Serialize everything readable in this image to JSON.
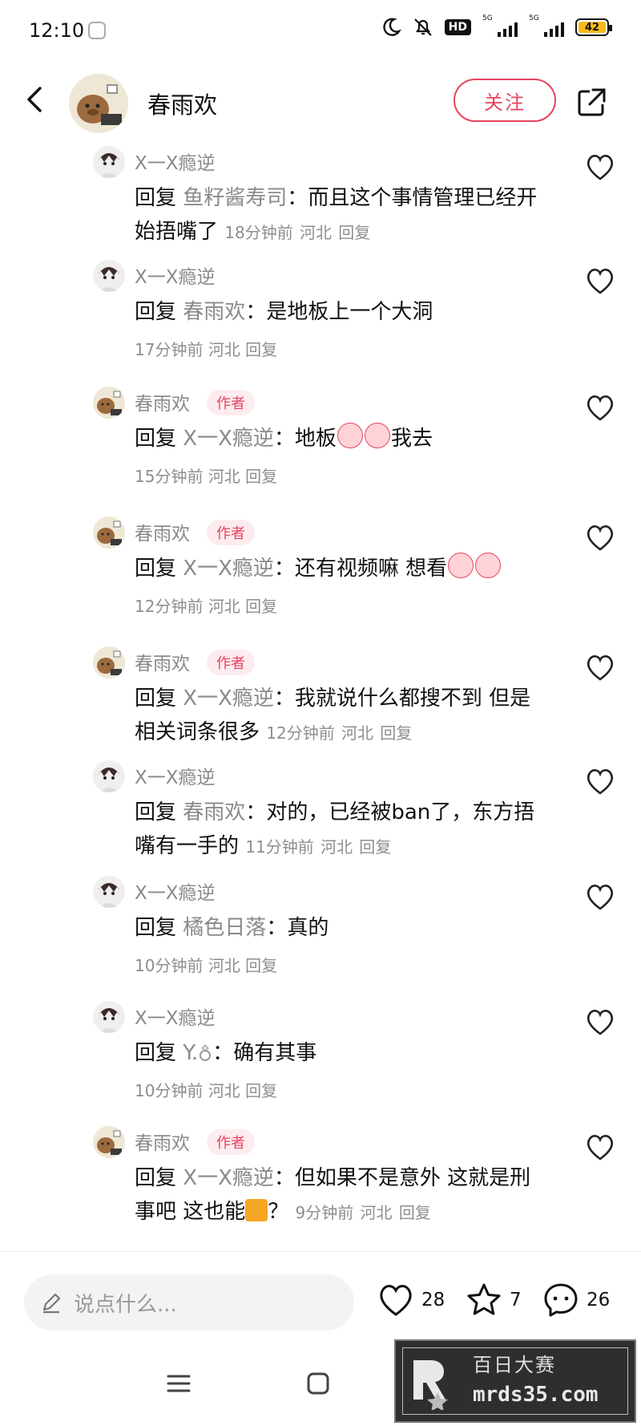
{
  "status_bar": {
    "time": "12:10",
    "hd_label": "HD",
    "network_1": "5G",
    "network_2": "5G",
    "battery": "42"
  },
  "header": {
    "author_name": "春雨欢",
    "follow_label": "关注"
  },
  "comments": [
    {
      "user": "X一X瘾逆",
      "is_author": false,
      "reply_word": "回复",
      "reply_to": "鱼籽酱寿司",
      "text": "而且这个事情管理已经开始捂嘴了",
      "time": "18分钟前",
      "location": "河北",
      "reply_label": "回复"
    },
    {
      "user": "X一X瘾逆",
      "is_author": false,
      "reply_word": "回复",
      "reply_to": "春雨欢",
      "text": "是地板上一个大洞",
      "time": "17分钟前",
      "location": "河北",
      "reply_label": "回复"
    },
    {
      "user": "春雨欢",
      "is_author": true,
      "author_badge": "作者",
      "reply_word": "回复",
      "reply_to": "X一X瘾逆",
      "text_before": "地板",
      "text_after": "我去",
      "time": "15分钟前",
      "location": "河北",
      "reply_label": "回复"
    },
    {
      "user": "春雨欢",
      "is_author": true,
      "author_badge": "作者",
      "reply_word": "回复",
      "reply_to": "X一X瘾逆",
      "text": "还有视频嘛 想看",
      "time": "12分钟前",
      "location": "河北",
      "reply_label": "回复"
    },
    {
      "user": "春雨欢",
      "is_author": true,
      "author_badge": "作者",
      "reply_word": "回复",
      "reply_to": "X一X瘾逆",
      "text": "我就说什么都搜不到 但是相关词条很多",
      "time": "12分钟前",
      "location": "河北",
      "reply_label": "回复"
    },
    {
      "user": "X一X瘾逆",
      "is_author": false,
      "reply_word": "回复",
      "reply_to": "春雨欢",
      "text": "对的，已经被ban了，东方捂嘴有一手的",
      "time": "11分钟前",
      "location": "河北",
      "reply_label": "回复"
    },
    {
      "user": "X一X瘾逆",
      "is_author": false,
      "reply_word": "回复",
      "reply_to": "橘色日落",
      "text": "真的",
      "time": "10分钟前",
      "location": "河北",
      "reply_label": "回复"
    },
    {
      "user": "X一X瘾逆",
      "is_author": false,
      "reply_word": "回复",
      "reply_to": "Y.",
      "text": "确有其事",
      "time": "10分钟前",
      "location": "河北",
      "reply_label": "回复"
    },
    {
      "user": "春雨欢",
      "is_author": true,
      "author_badge": "作者",
      "reply_word": "回复",
      "reply_to": "X一X瘾逆",
      "text_before": "但如果不是意外 这就是刑事吧 这也能",
      "text_after": "？",
      "time": "9分钟前",
      "location": "河北",
      "reply_label": "回复"
    }
  ],
  "bottom_bar": {
    "input_placeholder": "说点什么...",
    "likes": "28",
    "stars": "7",
    "comments": "26"
  },
  "watermark": {
    "title": "百日大赛",
    "url": "mrds35.com"
  },
  "colors": {
    "accent": "#e5455f",
    "secondary_text": "#8a8a8a"
  },
  "icons": [
    "back-arrow-icon",
    "share-icon",
    "heart-icon",
    "star-icon",
    "comment-bubble-icon",
    "pencil-icon",
    "menu-icon",
    "home-square-icon",
    "back-nav-icon"
  ]
}
